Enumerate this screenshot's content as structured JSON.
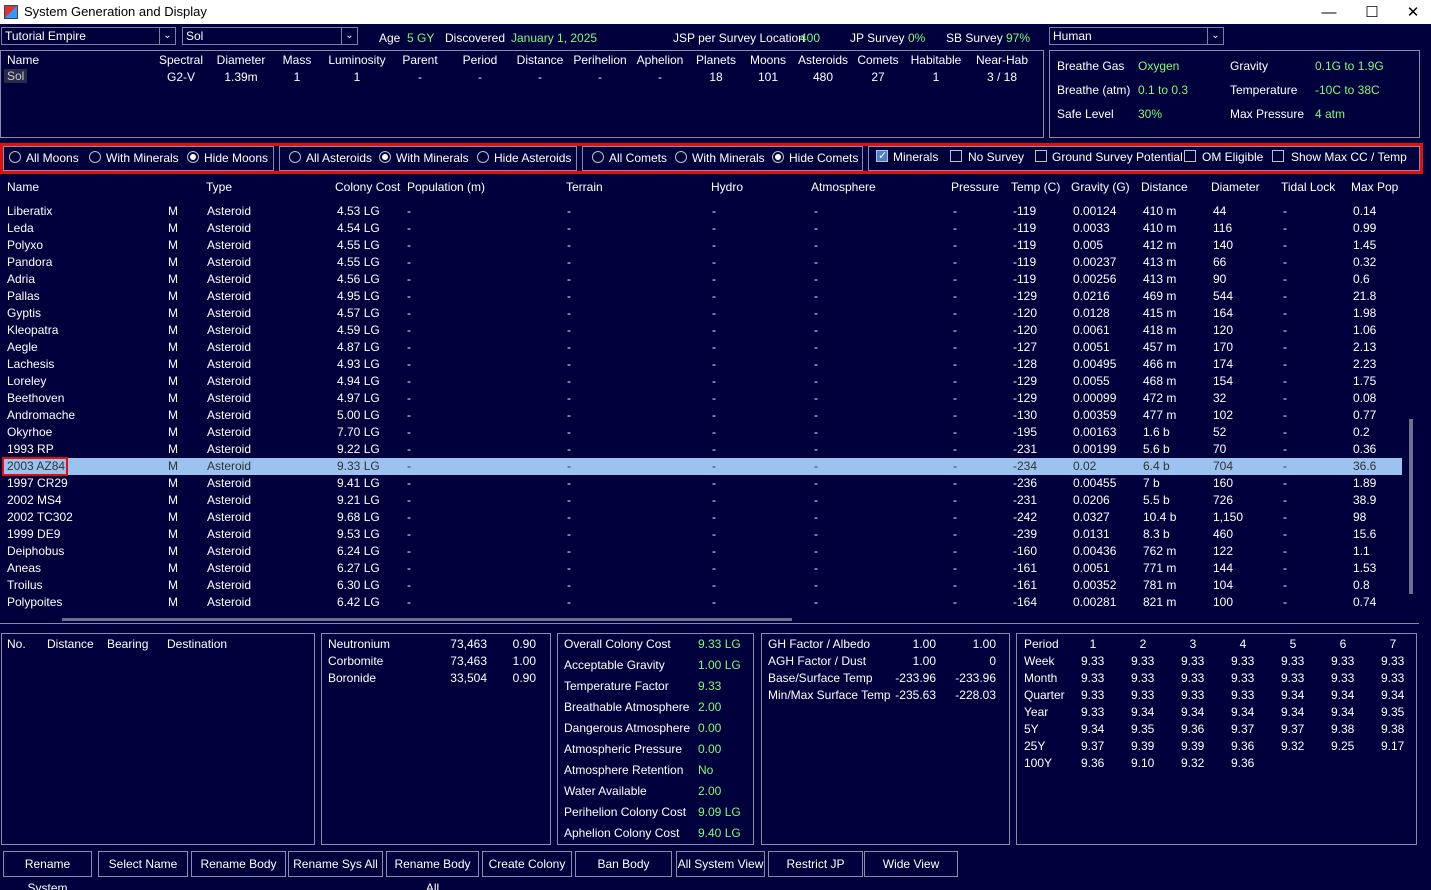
{
  "window": {
    "title": "System Generation and Display"
  },
  "selectors": {
    "empire": "Tutorial Empire",
    "system": "Sol",
    "species": "Human"
  },
  "summary": {
    "age_label": "Age",
    "age_value": "5 GY",
    "discovered_label": "Discovered",
    "discovered_value": "January 1, 2025",
    "jsp_label": "JSP per Survey Location",
    "jsp_value": "400",
    "jp_label": "JP Survey",
    "jp_value": "0%",
    "sb_label": "SB Survey",
    "sb_value": "97%"
  },
  "star_table": {
    "headers": [
      "Name",
      "Spectral",
      "Diameter",
      "Mass",
      "Luminosity",
      "Parent",
      "Period",
      "Distance",
      "Perihelion",
      "Aphelion",
      "Planets",
      "Moons",
      "Asteroids",
      "Comets",
      "Habitable",
      "Near-Hab"
    ],
    "row": [
      "Sol",
      "G2-V",
      "1.39m",
      "1",
      "1",
      "-",
      "-",
      "-",
      "-",
      "-",
      "18",
      "101",
      "480",
      "27",
      "1",
      "3 / 18"
    ]
  },
  "species_panel": {
    "breathe_gas_label": "Breathe Gas",
    "breathe_gas_value": "Oxygen",
    "gravity_label": "Gravity",
    "gravity_value": "0.1G  to  1.9G",
    "breathe_atm_label": "Breathe (atm)",
    "breathe_atm_value": "0.1  to  0.3",
    "temperature_label": "Temperature",
    "temperature_value": "-10C  to  38C",
    "safe_level_label": "Safe Level",
    "safe_level_value": "30%",
    "max_pressure_label": "Max Pressure",
    "max_pressure_value": "4 atm"
  },
  "filters": {
    "moons": [
      "All Moons",
      "With Minerals",
      "Hide Moons"
    ],
    "moons_selected": 2,
    "asteroids": [
      "All Asteroids",
      "With Minerals",
      "Hide Asteroids"
    ],
    "asteroids_selected": 1,
    "comets": [
      "All Comets",
      "With Minerals",
      "Hide Comets"
    ],
    "comets_selected": 2,
    "checks": [
      "Minerals",
      "No Survey",
      "Ground Survey Potential",
      "OM Eligible",
      "Show Max CC / Temp"
    ],
    "checks_state": [
      true,
      false,
      false,
      false,
      false
    ]
  },
  "body_table": {
    "headers": [
      "Name",
      "Type",
      "Colony Cost",
      "Population (m)",
      "Terrain",
      "Hydro",
      "Atmosphere",
      "Pressure",
      "Temp (C)",
      "Gravity (G)",
      "Distance",
      "Diameter",
      "Tidal Lock",
      "Max Pop"
    ],
    "rows": [
      [
        "Liberatix",
        "M",
        "Asteroid",
        "4.53 LG",
        "-",
        "-",
        "-",
        "-",
        "-",
        "-119",
        "0.00124",
        "410 m",
        "44",
        "-",
        "0.14"
      ],
      [
        "Leda",
        "M",
        "Asteroid",
        "4.54 LG",
        "-",
        "-",
        "-",
        "-",
        "-",
        "-119",
        "0.0033",
        "410 m",
        "116",
        "-",
        "0.99"
      ],
      [
        "Polyxo",
        "M",
        "Asteroid",
        "4.55 LG",
        "-",
        "-",
        "-",
        "-",
        "-",
        "-119",
        "0.005",
        "412 m",
        "140",
        "-",
        "1.45"
      ],
      [
        "Pandora",
        "M",
        "Asteroid",
        "4.55 LG",
        "-",
        "-",
        "-",
        "-",
        "-",
        "-119",
        "0.00237",
        "413 m",
        "66",
        "-",
        "0.32"
      ],
      [
        "Adria",
        "M",
        "Asteroid",
        "4.56 LG",
        "-",
        "-",
        "-",
        "-",
        "-",
        "-119",
        "0.00256",
        "413 m",
        "90",
        "-",
        "0.6"
      ],
      [
        "Pallas",
        "M",
        "Asteroid",
        "4.95 LG",
        "-",
        "-",
        "-",
        "-",
        "-",
        "-129",
        "0.0216",
        "469 m",
        "544",
        "-",
        "21.8"
      ],
      [
        "Gyptis",
        "M",
        "Asteroid",
        "4.57 LG",
        "-",
        "-",
        "-",
        "-",
        "-",
        "-120",
        "0.0128",
        "415 m",
        "164",
        "-",
        "1.98"
      ],
      [
        "Kleopatra",
        "M",
        "Asteroid",
        "4.59 LG",
        "-",
        "-",
        "-",
        "-",
        "-",
        "-120",
        "0.0061",
        "418 m",
        "120",
        "-",
        "1.06"
      ],
      [
        "Aegle",
        "M",
        "Asteroid",
        "4.87 LG",
        "-",
        "-",
        "-",
        "-",
        "-",
        "-127",
        "0.0051",
        "457 m",
        "170",
        "-",
        "2.13"
      ],
      [
        "Lachesis",
        "M",
        "Asteroid",
        "4.93 LG",
        "-",
        "-",
        "-",
        "-",
        "-",
        "-128",
        "0.00495",
        "466 m",
        "174",
        "-",
        "2.23"
      ],
      [
        "Loreley",
        "M",
        "Asteroid",
        "4.94 LG",
        "-",
        "-",
        "-",
        "-",
        "-",
        "-129",
        "0.0055",
        "468 m",
        "154",
        "-",
        "1.75"
      ],
      [
        "Beethoven",
        "M",
        "Asteroid",
        "4.97 LG",
        "-",
        "-",
        "-",
        "-",
        "-",
        "-129",
        "0.00099",
        "472 m",
        "32",
        "-",
        "0.08"
      ],
      [
        "Andromache",
        "M",
        "Asteroid",
        "5.00 LG",
        "-",
        "-",
        "-",
        "-",
        "-",
        "-130",
        "0.00359",
        "477 m",
        "102",
        "-",
        "0.77"
      ],
      [
        "Okyrhoe",
        "M",
        "Asteroid",
        "7.70 LG",
        "-",
        "-",
        "-",
        "-",
        "-",
        "-195",
        "0.00163",
        "1.6 b",
        "52",
        "-",
        "0.2"
      ],
      [
        "1993 RP",
        "M",
        "Asteroid",
        "9.22 LG",
        "-",
        "-",
        "-",
        "-",
        "-",
        "-231",
        "0.00199",
        "5.6 b",
        "70",
        "-",
        "0.36"
      ],
      [
        "2003 AZ84",
        "M",
        "Asteroid",
        "9.33 LG",
        "-",
        "-",
        "-",
        "-",
        "-",
        "-234",
        "0.02",
        "6.4 b",
        "704",
        "-",
        "36.6"
      ],
      [
        "1997 CR29",
        "M",
        "Asteroid",
        "9.41 LG",
        "-",
        "-",
        "-",
        "-",
        "-",
        "-236",
        "0.00455",
        "7 b",
        "160",
        "-",
        "1.89"
      ],
      [
        "2002 MS4",
        "M",
        "Asteroid",
        "9.21 LG",
        "-",
        "-",
        "-",
        "-",
        "-",
        "-231",
        "0.0206",
        "5.5 b",
        "726",
        "-",
        "38.9"
      ],
      [
        "2002 TC302",
        "M",
        "Asteroid",
        "9.68 LG",
        "-",
        "-",
        "-",
        "-",
        "-",
        "-242",
        "0.0327",
        "10.4 b",
        "1,150",
        "-",
        "98"
      ],
      [
        "1999 DE9",
        "M",
        "Asteroid",
        "9.53 LG",
        "-",
        "-",
        "-",
        "-",
        "-",
        "-239",
        "0.0131",
        "8.3 b",
        "460",
        "-",
        "15.6"
      ],
      [
        "Deiphobus",
        "M",
        "Asteroid",
        "6.24 LG",
        "-",
        "-",
        "-",
        "-",
        "-",
        "-160",
        "0.00436",
        "762 m",
        "122",
        "-",
        "1.1"
      ],
      [
        "Aneas",
        "M",
        "Asteroid",
        "6.27 LG",
        "-",
        "-",
        "-",
        "-",
        "-",
        "-161",
        "0.0051",
        "771 m",
        "144",
        "-",
        "1.53"
      ],
      [
        "Troilus",
        "M",
        "Asteroid",
        "6.30 LG",
        "-",
        "-",
        "-",
        "-",
        "-",
        "-161",
        "0.00352",
        "781 m",
        "104",
        "-",
        "0.8"
      ],
      [
        "Polypoites",
        "M",
        "Asteroid",
        "6.42 LG",
        "-",
        "-",
        "-",
        "-",
        "-",
        "-164",
        "0.00281",
        "821 m",
        "100",
        "-",
        "0.74"
      ]
    ],
    "selected_index": 15
  },
  "jump_panel": {
    "headers": [
      "No.",
      "Distance",
      "Bearing",
      "Destination"
    ]
  },
  "minerals": [
    [
      "Neutronium",
      "73,463",
      "0.90"
    ],
    [
      "Corbomite",
      "73,463",
      "1.00"
    ],
    [
      "Boronide",
      "33,504",
      "0.90"
    ]
  ],
  "colony_cost": [
    [
      "Overall Colony Cost",
      "9.33 LG"
    ],
    [
      "Acceptable Gravity",
      "1.00 LG"
    ],
    [
      "Temperature Factor",
      "9.33"
    ],
    [
      "Breathable Atmosphere",
      "2.00"
    ],
    [
      "Dangerous Atmosphere",
      "0.00"
    ],
    [
      "Atmospheric Pressure",
      "0.00"
    ],
    [
      "Atmosphere Retention",
      "No"
    ],
    [
      "Water Available",
      "2.00"
    ],
    [
      "Perihelion Colony Cost",
      "9.09 LG"
    ],
    [
      "Aphelion Colony Cost",
      "9.40 LG"
    ]
  ],
  "factors": [
    [
      "GH Factor / Albedo",
      "1.00",
      "1.00"
    ],
    [
      "AGH Factor / Dust",
      "1.00",
      "0"
    ],
    [
      "Base/Surface Temp",
      "-233.96",
      "-233.96"
    ],
    [
      "Min/Max Surface Temp",
      "-235.63",
      "-228.03"
    ]
  ],
  "periods": {
    "headers": [
      "Period",
      "1",
      "2",
      "3",
      "4",
      "5",
      "6",
      "7"
    ],
    "rows": [
      [
        "Week",
        "9.33",
        "9.33",
        "9.33",
        "9.33",
        "9.33",
        "9.33",
        "9.33"
      ],
      [
        "Month",
        "9.33",
        "9.33",
        "9.33",
        "9.33",
        "9.33",
        "9.33",
        "9.33"
      ],
      [
        "Quarter",
        "9.33",
        "9.33",
        "9.33",
        "9.33",
        "9.34",
        "9.34",
        "9.34"
      ],
      [
        "Year",
        "9.33",
        "9.34",
        "9.34",
        "9.34",
        "9.34",
        "9.34",
        "9.35"
      ],
      [
        "5Y",
        "9.34",
        "9.35",
        "9.36",
        "9.37",
        "9.37",
        "9.38",
        "9.38"
      ],
      [
        "25Y",
        "9.37",
        "9.39",
        "9.39",
        "9.36",
        "9.32",
        "9.25",
        "9.17"
      ],
      [
        "100Y",
        "9.36",
        "9.10",
        "9.32",
        "9.36",
        "",
        "",
        ""
      ]
    ]
  },
  "buttons": [
    "Rename System",
    "Select Name",
    "Rename Body",
    "Rename Sys All",
    "Rename Body All",
    "Create Colony",
    "Ban Body",
    "All System View",
    "Restrict JP",
    "Wide View"
  ],
  "colors": {
    "background": "#00003c",
    "value_green": "#7cfc7c",
    "selection": "#9cc3ef",
    "highlight_red": "#e01010"
  }
}
